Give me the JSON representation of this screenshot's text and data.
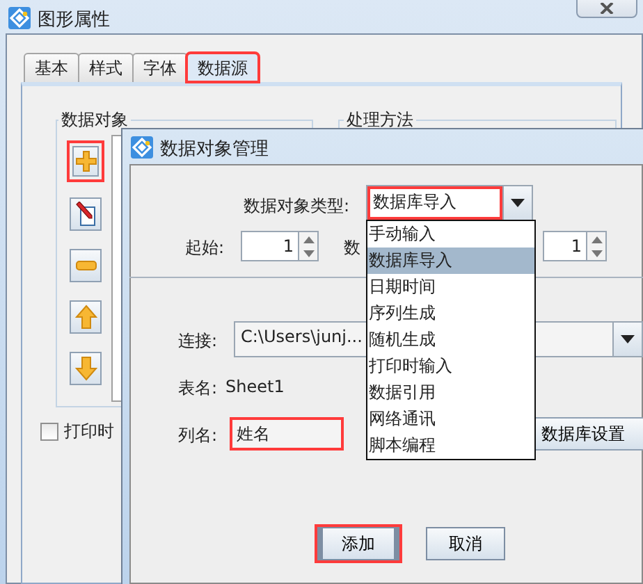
{
  "main_window": {
    "title": "图形属性",
    "tabs": [
      {
        "label": "基本",
        "selected": false,
        "highlighted": false
      },
      {
        "label": "样式",
        "selected": false,
        "highlighted": false
      },
      {
        "label": "字体",
        "selected": false,
        "highlighted": false
      },
      {
        "label": "数据源",
        "selected": true,
        "highlighted": true
      }
    ],
    "groups": [
      {
        "title": "数据对象"
      },
      {
        "title": "处理方法"
      }
    ],
    "tool_buttons": [
      {
        "kind": "add",
        "highlighted": true
      },
      {
        "kind": "edit",
        "highlighted": false
      },
      {
        "kind": "remove",
        "highlighted": false
      },
      {
        "kind": "up",
        "highlighted": false
      },
      {
        "kind": "down",
        "highlighted": false
      }
    ],
    "checkbox": {
      "label": "打印时",
      "checked": false
    }
  },
  "dialog": {
    "title": "数据对象管理",
    "type_label": "数据对象类型:",
    "type_value": "数据库导入",
    "type_highlighted": true,
    "start_label": "起始:",
    "start_value": "1",
    "count_label": "数",
    "count_value": "1",
    "connection_label": "连接:",
    "connection_value": "C:\\Users\\junj...",
    "table_label": "表名:",
    "table_value": "Sheet1",
    "column_label": "列名:",
    "column_value": "姓名",
    "column_highlighted": true,
    "db_settings_button": "数据库设置",
    "buttons": [
      {
        "label": "添加",
        "highlighted": true
      },
      {
        "label": "取消",
        "highlighted": false
      }
    ],
    "dropdown": [
      {
        "label": "手动输入",
        "selected": false
      },
      {
        "label": "数据库导入",
        "selected": true
      },
      {
        "label": "日期时间",
        "selected": false
      },
      {
        "label": "序列生成",
        "selected": false
      },
      {
        "label": "随机生成",
        "selected": false
      },
      {
        "label": "打印时输入",
        "selected": false
      },
      {
        "label": "数据引用",
        "selected": false
      },
      {
        "label": "网络通讯",
        "selected": false
      },
      {
        "label": "脚本编程",
        "selected": false
      }
    ]
  }
}
